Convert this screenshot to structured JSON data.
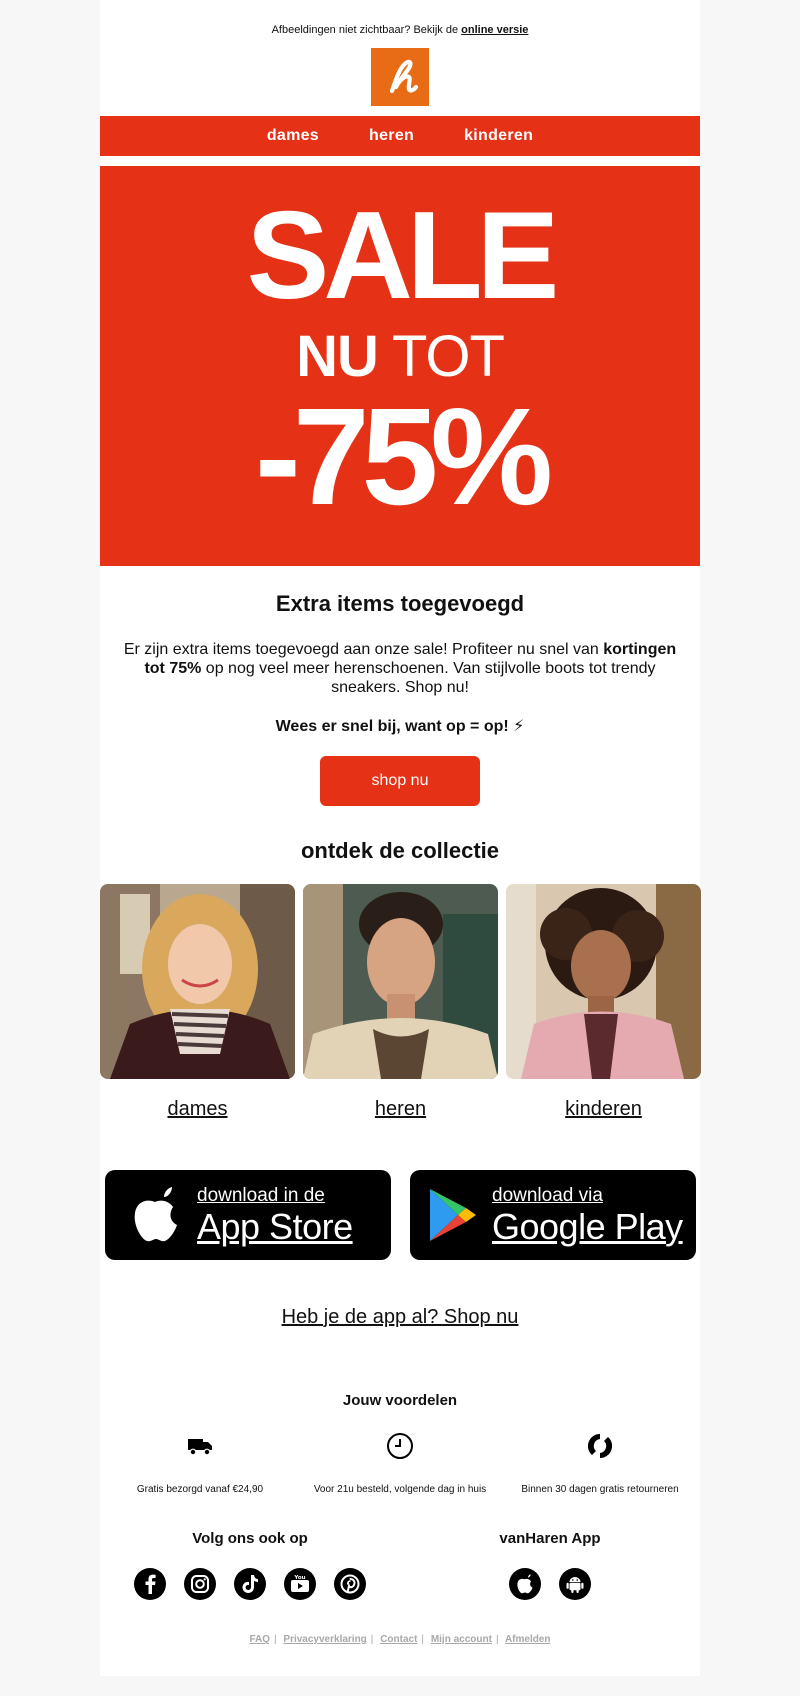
{
  "preheader": {
    "text": "Afbeeldingen niet zichtbaar? Bekijk de",
    "link": "online versie"
  },
  "logo": {
    "letter": "h",
    "color": "#e86c16"
  },
  "nav": {
    "items": [
      "dames",
      "heren",
      "kinderen"
    ],
    "color": "#e53216"
  },
  "hero": {
    "sale": "SALE",
    "nu": "NU",
    "tot": "TOT",
    "percent": "-75%"
  },
  "intro": {
    "title": "Extra items toegevoegd",
    "text_a": "Er zijn extra items toegevoegd aan onze sale! Profiteer nu snel van",
    "text_bold": "kortingen tot 75%",
    "text_b": "op nog veel meer herenschoenen. Van stijlvolle boots tot trendy sneakers. Shop nu!",
    "hurry": "Wees er snel bij, want op = op! ⚡",
    "button": "shop nu"
  },
  "collection": {
    "title": "ontdek de collectie",
    "tiles": [
      {
        "label": "dames",
        "image": "woman-with-scarf"
      },
      {
        "label": "heren",
        "image": "man-portrait"
      },
      {
        "label": "kinderen",
        "image": "girl-pink-jacket"
      }
    ]
  },
  "apps": {
    "appstore": {
      "small": "download in de",
      "big": "App Store"
    },
    "googleplay": {
      "small": "download via",
      "big": "Google Play"
    },
    "link": "Heb je de app al? Shop nu"
  },
  "benefits": {
    "title": "Jouw voordelen",
    "items": [
      {
        "icon": "truck-icon",
        "text": "Gratis bezorgd vanaf €24,90"
      },
      {
        "icon": "clock-icon",
        "text": "Voor 21u besteld, volgende dag in huis"
      },
      {
        "icon": "return-icon",
        "text": "Binnen 30 dagen gratis retourneren"
      }
    ]
  },
  "social": {
    "title": "Volg ons ook op",
    "icons": [
      "facebook-icon",
      "instagram-icon",
      "tiktok-icon",
      "youtube-icon",
      "pinterest-icon"
    ]
  },
  "app_section": {
    "title": "vanHaren App",
    "icons": [
      "apple-icon",
      "android-icon"
    ]
  },
  "footer": {
    "links": [
      "FAQ",
      "Privacyverklaring",
      "Contact",
      "Mijn account",
      "Afmelden"
    ]
  }
}
